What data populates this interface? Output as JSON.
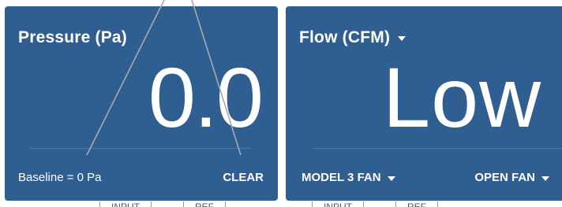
{
  "pressure": {
    "title": "Pressure (Pa)",
    "value": "0.0",
    "baseline": "Baseline = 0 Pa",
    "clear_label": "CLEAR"
  },
  "flow": {
    "title": "Flow (CFM)",
    "value": "Low",
    "fan_model": "MODEL 3 FAN",
    "fan_config": "OPEN FAN"
  },
  "bottom_tabs": {
    "left": [
      "INPUT",
      "REF"
    ],
    "right": [
      "INPUT",
      "REF"
    ]
  },
  "colors": {
    "panel": "#2f5f91",
    "text": "#ffffff",
    "callout_line": "#aaaaaa"
  },
  "icons": [
    "caret-down-icon"
  ]
}
